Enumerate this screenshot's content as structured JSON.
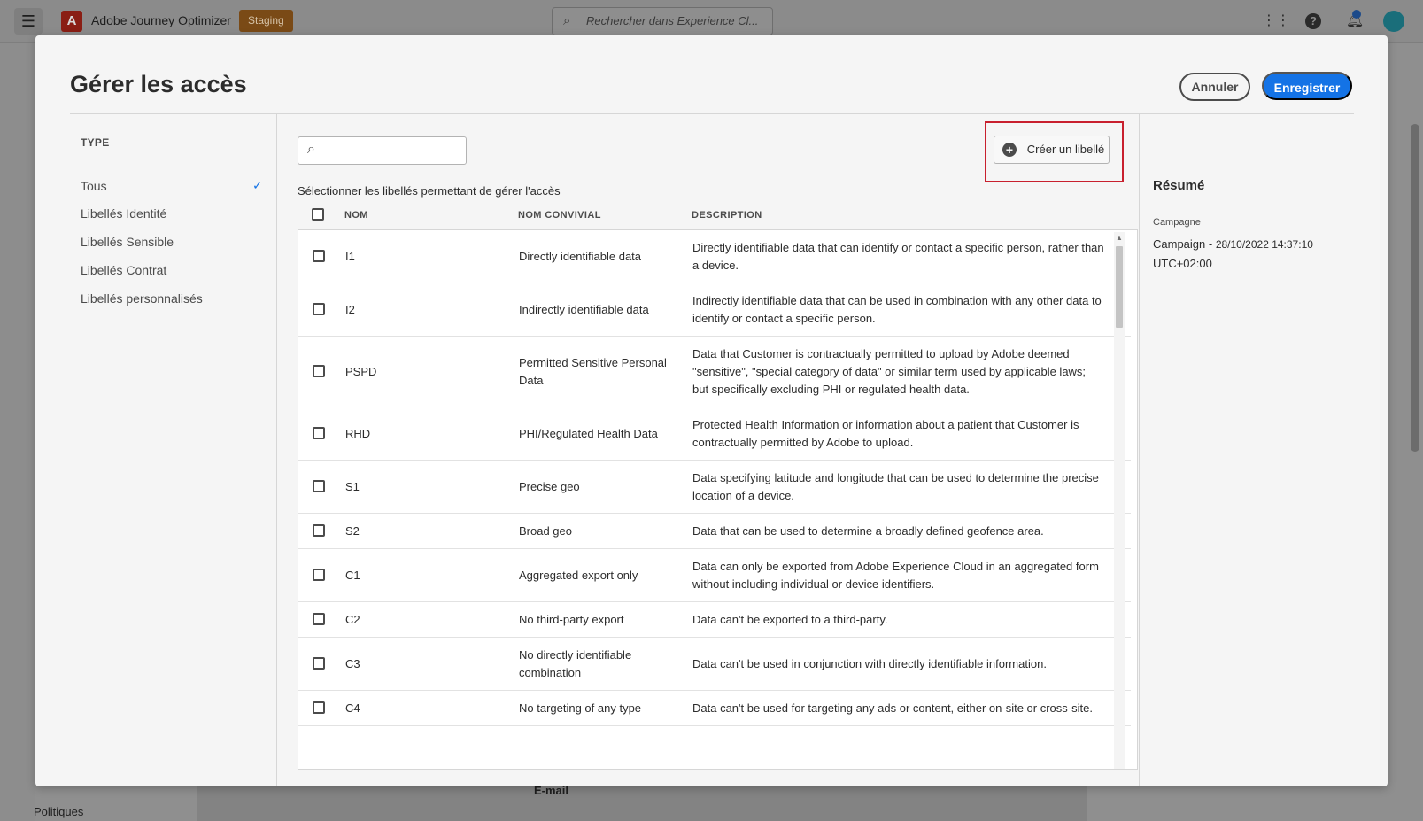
{
  "app": {
    "menu_icon": "hamburger-icon",
    "logo_letter": "A",
    "title": "Adobe Journey Optimizer",
    "environment": "Staging",
    "search_placeholder": "Rechercher dans Experience Cl...",
    "icons": [
      "apps-grid-icon",
      "help-icon",
      "bell-icon",
      "avatar"
    ]
  },
  "background": {
    "email_label": "E-mail",
    "policies_label": "Politiques"
  },
  "modal": {
    "title": "Gérer les accès",
    "cancel_label": "Annuler",
    "save_label": "Enregistrer",
    "type_heading": "TYPE",
    "type_items": [
      {
        "label": "Tous",
        "selected": true
      },
      {
        "label": "Libellés Identité",
        "selected": false
      },
      {
        "label": "Libellés Sensible",
        "selected": false
      },
      {
        "label": "Libellés Contrat",
        "selected": false
      },
      {
        "label": "Libellés personnalisés",
        "selected": false
      }
    ],
    "search_value": "",
    "create_label": "Créer un libellé",
    "instruction": "Sélectionner les libellés permettant de gérer l'accès",
    "columns": [
      "NOM",
      "NOM CONVIVIAL",
      "DESCRIPTION"
    ],
    "rows": [
      {
        "name": "I1",
        "friendly": "Directly identifiable data",
        "description": "Directly identifiable data that can identify or contact a specific person, rather than a device."
      },
      {
        "name": "I2",
        "friendly": "Indirectly identifiable data",
        "description": "Indirectly identifiable data that can be used in combination with any other data to identify or contact a specific person."
      },
      {
        "name": "PSPD",
        "friendly": "Permitted Sensitive Personal Data",
        "description": "Data that Customer is contractually permitted to upload by Adobe deemed \"sensitive\", \"special category of data\" or similar term used by applicable laws; but specifically excluding PHI or regulated health data."
      },
      {
        "name": "RHD",
        "friendly": "PHI/Regulated Health Data",
        "description": "Protected Health Information or information about a patient that Customer is contractually permitted by Adobe to upload."
      },
      {
        "name": "S1",
        "friendly": "Precise geo",
        "description": "Data specifying latitude and longitude that can be used to determine the precise location of a device."
      },
      {
        "name": "S2",
        "friendly": "Broad geo",
        "description": "Data that can be used to determine a broadly defined geofence area."
      },
      {
        "name": "C1",
        "friendly": "Aggregated export only",
        "description": "Data can only be exported from Adobe Experience Cloud in an aggregated form without including individual or device identifiers."
      },
      {
        "name": "C2",
        "friendly": "No third-party export",
        "description": "Data can't be exported to a third-party."
      },
      {
        "name": "C3",
        "friendly": "No directly identifiable combination",
        "description": "Data can't be used in conjunction with directly identifiable information."
      },
      {
        "name": "C4",
        "friendly": "No targeting of any type",
        "description": "Data can't be used for targeting any ads or content, either on-site or cross-site."
      }
    ],
    "summary": {
      "title": "Résumé",
      "label": "Campagne",
      "value_main": "Campaign - ",
      "value_date": "28/10/2022 14:37:10",
      "value_tz": "UTC+02:00"
    }
  },
  "colors": {
    "accent": "#1473e6",
    "highlight": "#c8202e",
    "badge": "#7a4a16"
  }
}
